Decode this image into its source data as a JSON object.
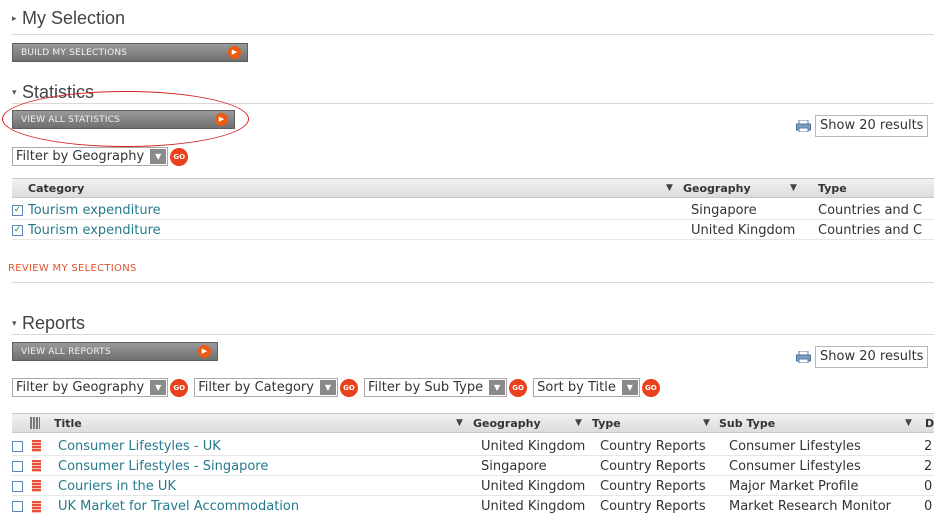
{
  "my_selection": {
    "title": "My Selection",
    "button": "BUILD MY SELECTIONS"
  },
  "statistics": {
    "title": "Statistics",
    "button": "VIEW ALL STATISTICS",
    "show_results": "Show 20 results",
    "filters": [
      {
        "label": "Filter by Geography",
        "go": "GO"
      }
    ],
    "columns": [
      "Category",
      "Geography",
      "Type"
    ],
    "rows": [
      {
        "checked": true,
        "category": "Tourism expenditure",
        "geography": "Singapore",
        "type": "Countries and C"
      },
      {
        "checked": true,
        "category": "Tourism expenditure",
        "geography": "United Kingdom",
        "type": "Countries and C"
      }
    ],
    "review": "REVIEW MY SELECTIONS"
  },
  "reports": {
    "title": "Reports",
    "button": "VIEW ALL REPORTS",
    "show_results": "Show 20 results",
    "filters": [
      {
        "label": "Filter by Geography",
        "go": "GO"
      },
      {
        "label": "Filter by Category",
        "go": "GO"
      },
      {
        "label": "Filter by Sub Type",
        "go": "GO"
      },
      {
        "label": "Sort by Title",
        "go": "GO"
      }
    ],
    "columns": [
      "Title",
      "Geography",
      "Type",
      "Sub Type",
      "D"
    ],
    "rows": [
      {
        "title": "Consumer Lifestyles - UK",
        "geography": "United Kingdom",
        "type": "Country Reports",
        "subtype": "Consumer Lifestyles",
        "d": "2"
      },
      {
        "title": "Consumer Lifestyles - Singapore",
        "geography": "Singapore",
        "type": "Country Reports",
        "subtype": "Consumer Lifestyles",
        "d": "2"
      },
      {
        "title": "Couriers in the UK",
        "geography": "United Kingdom",
        "type": "Country Reports",
        "subtype": "Major Market Profile",
        "d": "0"
      },
      {
        "title": "UK Market for Travel Accommodation",
        "geography": "United Kingdom",
        "type": "Country Reports",
        "subtype": "Market Research Monitor",
        "d": "0"
      }
    ]
  },
  "colors": {
    "accent": "#e8411b",
    "link": "#267a8c",
    "annotation": "#d42222"
  }
}
